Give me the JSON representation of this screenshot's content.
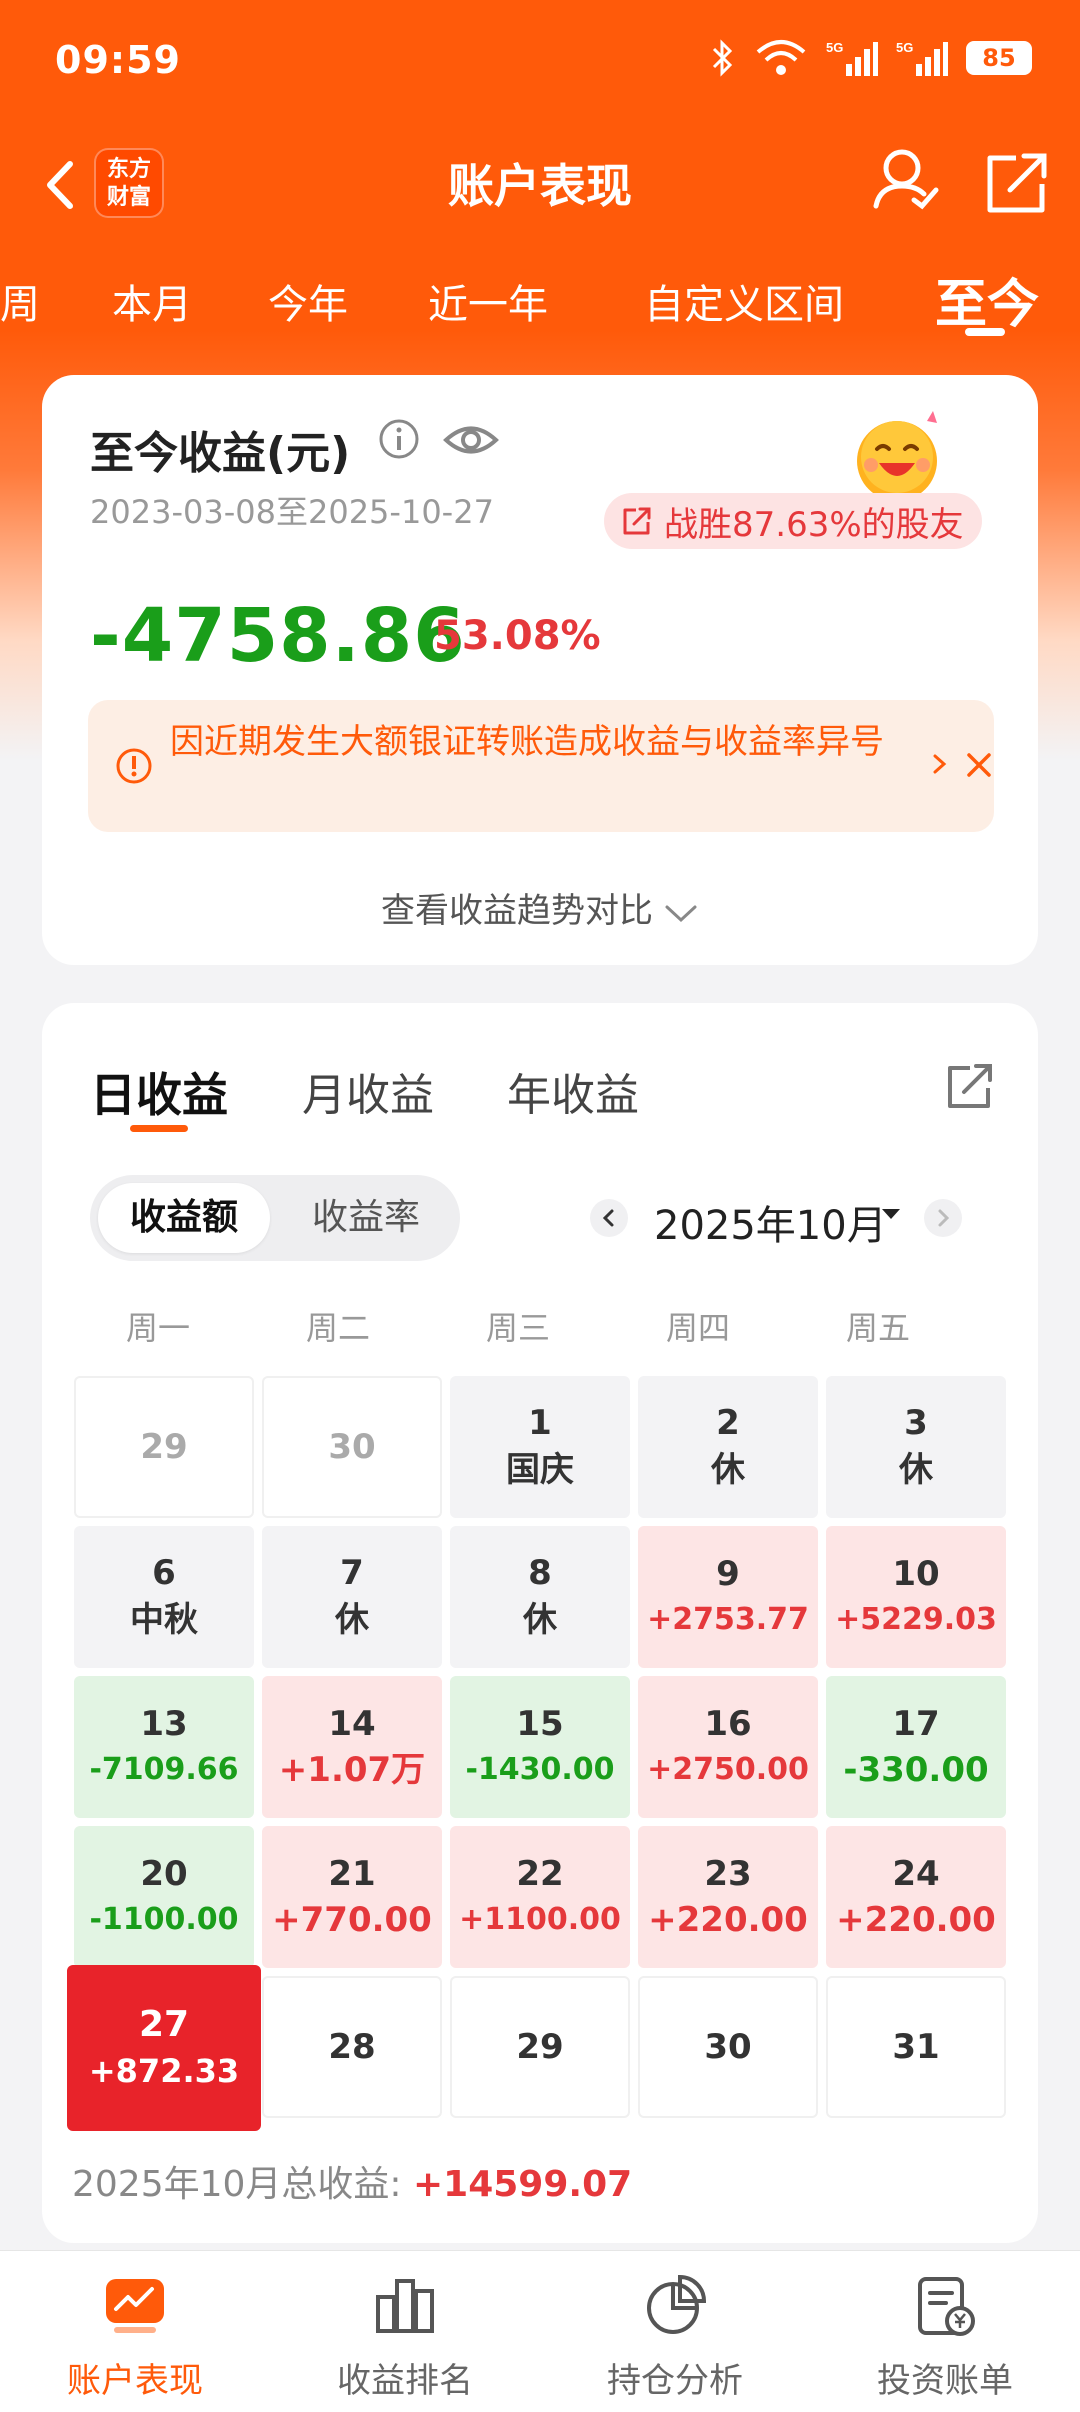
{
  "status": {
    "time": "09:59",
    "battery": "85"
  },
  "header": {
    "title": "账户表现",
    "logo_line1": "东方",
    "logo_line2": "财富"
  },
  "period_tabs": [
    {
      "label": "周"
    },
    {
      "label": "本月"
    },
    {
      "label": "今年"
    },
    {
      "label": "近一年"
    },
    {
      "label": "自定义区间"
    },
    {
      "label": "至今"
    }
  ],
  "summary": {
    "title": "至今收益(元)",
    "date_range": "2023-03-08至2025-10-27",
    "beat_text": "战胜87.63%的股友",
    "total_profit": "-4758.86",
    "profit_rate": "53.08%",
    "notice": "因近期发生大额银证转账造成收益与收益率异号",
    "trend_link": "查看收益趋势对比"
  },
  "calendar": {
    "tabs": [
      {
        "label": "日收益"
      },
      {
        "label": "月收益"
      },
      {
        "label": "年收益"
      }
    ],
    "segments": [
      {
        "label": "收益额"
      },
      {
        "label": "收益率"
      }
    ],
    "month": "2025年10月",
    "weekdays": [
      "周一",
      "周二",
      "周三",
      "周四",
      "周五"
    ],
    "cells": [
      {
        "day": "29",
        "sub": "",
        "value": ""
      },
      {
        "day": "30",
        "sub": "",
        "value": ""
      },
      {
        "day": "1",
        "sub": "国庆",
        "value": ""
      },
      {
        "day": "2",
        "sub": "休",
        "value": ""
      },
      {
        "day": "3",
        "sub": "休",
        "value": ""
      },
      {
        "day": "6",
        "sub": "中秋",
        "value": ""
      },
      {
        "day": "7",
        "sub": "休",
        "value": ""
      },
      {
        "day": "8",
        "sub": "休",
        "value": ""
      },
      {
        "day": "9",
        "sub": "",
        "value": "+2753.77"
      },
      {
        "day": "10",
        "sub": "",
        "value": "+5229.03"
      },
      {
        "day": "13",
        "sub": "",
        "value": "-7109.66"
      },
      {
        "day": "14",
        "sub": "",
        "value": "+1.07万"
      },
      {
        "day": "15",
        "sub": "",
        "value": "-1430.00"
      },
      {
        "day": "16",
        "sub": "",
        "value": "+2750.00"
      },
      {
        "day": "17",
        "sub": "",
        "value": "-330.00"
      },
      {
        "day": "20",
        "sub": "",
        "value": "-1100.00"
      },
      {
        "day": "21",
        "sub": "",
        "value": "+770.00"
      },
      {
        "day": "22",
        "sub": "",
        "value": "+1100.00"
      },
      {
        "day": "23",
        "sub": "",
        "value": "+220.00"
      },
      {
        "day": "24",
        "sub": "",
        "value": "+220.00"
      },
      {
        "day": "27",
        "sub": "",
        "value": "+872.33"
      },
      {
        "day": "28",
        "sub": "",
        "value": ""
      },
      {
        "day": "29",
        "sub": "",
        "value": ""
      },
      {
        "day": "30",
        "sub": "",
        "value": ""
      },
      {
        "day": "31",
        "sub": "",
        "value": ""
      }
    ],
    "month_total_label": "2025年10月总收益: ",
    "month_total_value": "+14599.07"
  },
  "bottom_nav": [
    {
      "label": "账户表现"
    },
    {
      "label": "收益排名"
    },
    {
      "label": "持仓分析"
    },
    {
      "label": "投资账单"
    }
  ],
  "colors": {
    "brand": "#ff5a0a",
    "up": "#e5383b",
    "down": "#1a9e1a"
  }
}
